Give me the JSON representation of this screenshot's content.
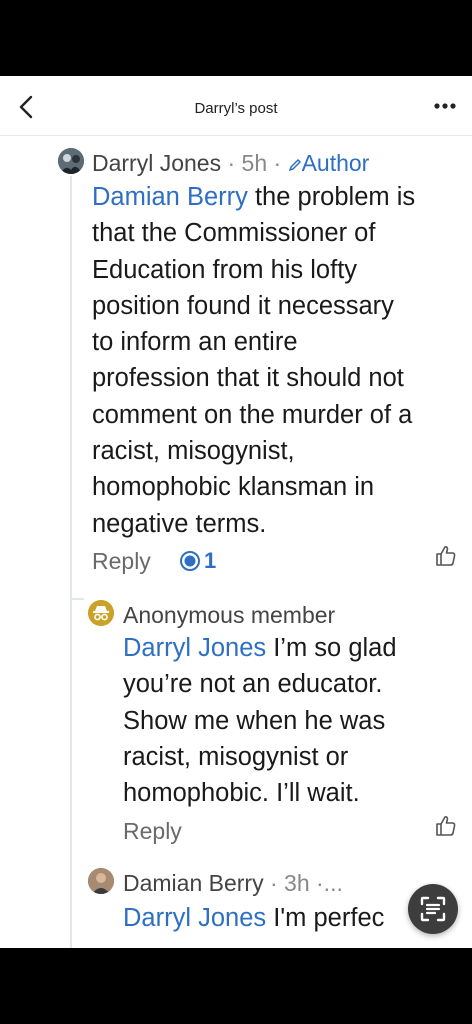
{
  "header": {
    "title": "Darryl’s post",
    "back_icon": "chevron-left-icon",
    "more_icon": "more-horizontal-icon"
  },
  "comments": [
    {
      "author": "Darryl Jones",
      "meta_time": "· 5h ·",
      "badge": "Author",
      "badge_icon": "pencil-icon",
      "mention": "Damian Berry",
      "lines": [
        " the problem is",
        "that the Commissioner of",
        "Education from his lofty",
        "position found it necessary",
        "to inform an entire",
        "profession that it should not",
        "comment on the murder of a",
        "racist, misogynist,",
        "homophobic klansman in",
        "negative terms."
      ],
      "reply_label": "Reply",
      "like_count": "1"
    },
    {
      "author": "Anonymous member",
      "mention": "Darryl Jones",
      "lines": [
        " I’m so glad",
        "you’re not an educator.",
        "Show me when he was",
        "racist, misogynist or",
        "homophobic. I’ll wait."
      ],
      "reply_label": "Reply"
    },
    {
      "author": "Damian Berry",
      "meta_time": "· 3h ·...",
      "mention": "Darryl Jones",
      "lines": [
        " I'm perfec"
      ]
    }
  ],
  "colors": {
    "accent": "#2e6fc4",
    "text": "#1a1a1a",
    "muted": "#6a6a6a"
  }
}
